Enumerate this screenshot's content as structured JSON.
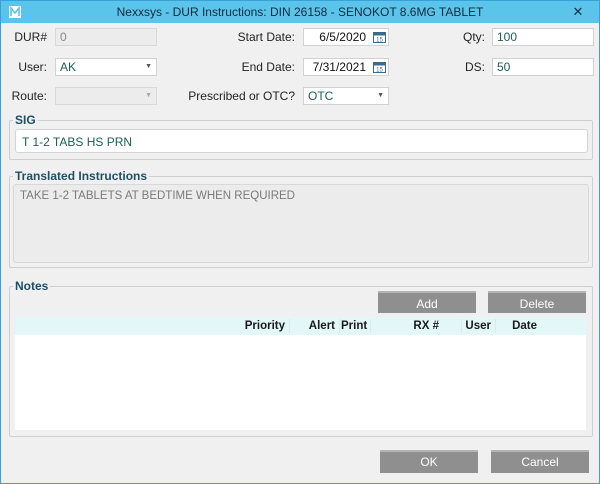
{
  "window": {
    "title": "Nexxsys - DUR Instructions: DIN 26158 - SENOKOT 8.6MG TABLET",
    "close_glyph": "✕"
  },
  "form": {
    "dur_label": "DUR#",
    "dur_value": "0",
    "user_label": "User:",
    "user_value": "AK",
    "route_label": "Route:",
    "route_value": "",
    "start_date_label": "Start Date:",
    "start_date_value": "6/5/2020",
    "end_date_label": "End Date:",
    "end_date_value": "7/31/2021",
    "prescribed_label": "Prescribed or OTC?",
    "prescribed_value": "OTC",
    "qty_label": "Qty:",
    "qty_value": "100",
    "ds_label": "DS:",
    "ds_value": "50",
    "calendar_day": "15"
  },
  "sig": {
    "title": "SIG",
    "value": "T 1-2 TABS HS PRN"
  },
  "translated": {
    "title": "Translated Instructions",
    "value": "TAKE 1-2 TABLETS AT BEDTIME WHEN REQUIRED"
  },
  "notes": {
    "title": "Notes",
    "add_label": "Add",
    "delete_label": "Delete",
    "columns": [
      "Priority",
      "Alert",
      "Print",
      "RX #",
      "User",
      "Date"
    ],
    "rows": []
  },
  "footer": {
    "ok_label": "OK",
    "cancel_label": "Cancel"
  },
  "colors": {
    "titlebar": "#5bc4ea",
    "grid_header": "#e4f7f8",
    "button": "#8f8f8f",
    "value_text": "#1b5e57"
  }
}
